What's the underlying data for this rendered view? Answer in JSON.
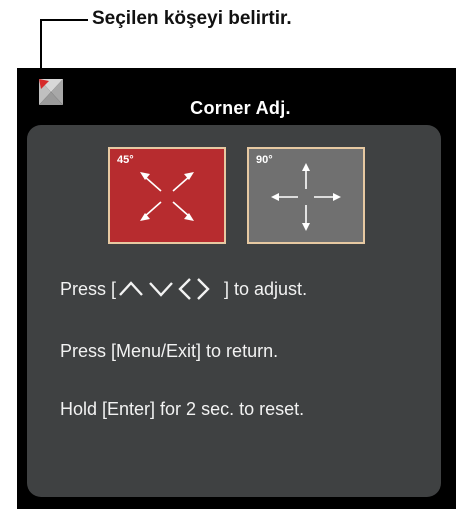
{
  "callout": {
    "text": "Seçilen köşeyi belirtir."
  },
  "osd": {
    "title": "Corner Adj.",
    "options": [
      {
        "label": "45°",
        "selected": true,
        "color": "#b72c2f"
      },
      {
        "label": "90°",
        "selected": false,
        "color": "#707070"
      }
    ],
    "instructions": {
      "adjust_prefix": "Press [",
      "adjust_suffix": "] to adjust.",
      "return": "Press [Menu/Exit] to return.",
      "reset": "Hold [Enter] for 2 sec. to reset."
    }
  },
  "icons": [
    "corner-indicator-icon",
    "arrow-up-icon",
    "arrow-down-icon",
    "arrow-left-icon",
    "arrow-right-icon"
  ]
}
